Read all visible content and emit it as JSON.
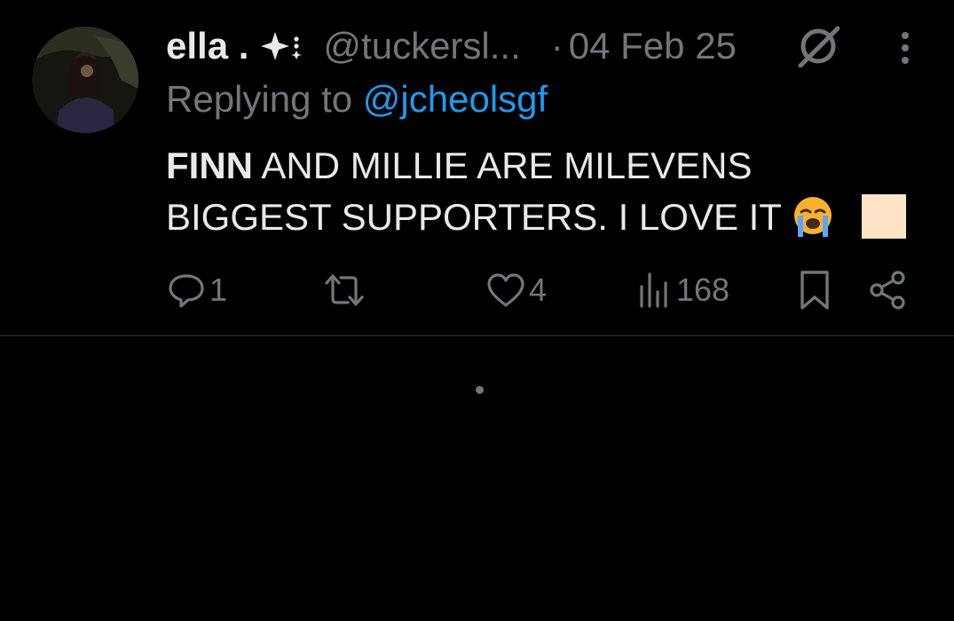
{
  "tweet": {
    "display_name": "ella .",
    "handle": "@tuckersl...",
    "separator": "·",
    "date": "04 Feb 25",
    "replying_prefix": "Replying to ",
    "replying_to": "@jcheolsgf",
    "text_bold": "FINN",
    "text_line1_rest": " AND MILLIE ARE MILEVENS",
    "text_line2": "BIGGEST SUPPORTERS. I LOVE IT",
    "emojis": [
      "loudly-crying-face",
      "peach-square"
    ],
    "actions": {
      "reply_count": "1",
      "retweet_count": "",
      "like_count": "4",
      "view_count": "168"
    }
  },
  "colors": {
    "background": "#000000",
    "text": "#e7e9ea",
    "secondary": "#71767b",
    "accent": "#1d9bf0",
    "divider": "#2f3336"
  },
  "icons": [
    "sparkle-icon",
    "grok-icon",
    "more-icon",
    "reply-icon",
    "retweet-icon",
    "like-icon",
    "views-icon",
    "bookmark-icon",
    "share-icon"
  ]
}
